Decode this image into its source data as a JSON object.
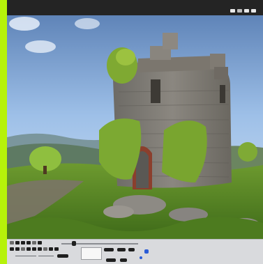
{
  "app": {
    "topbar_icons": [
      "window-icon",
      "grid-icon",
      "tile-icon",
      "minimize-icon"
    ],
    "canvas_image": "stone-tower-illustration",
    "accent": "#b6f20a",
    "active_dot": "#2a5cd6"
  }
}
